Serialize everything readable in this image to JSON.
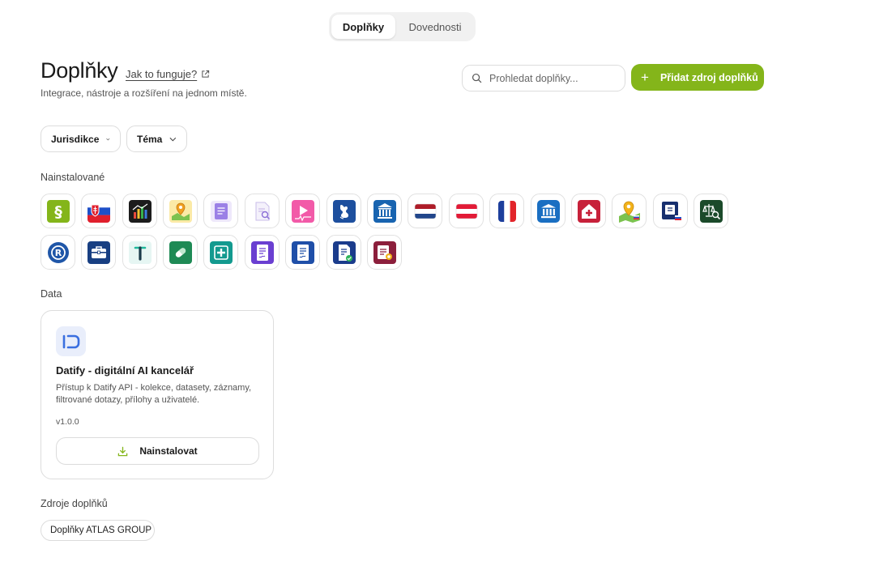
{
  "tabs": [
    {
      "label": "Doplňky"
    },
    {
      "label": "Dovednosti"
    }
  ],
  "header": {
    "title": "Doplňky",
    "how_link": "Jak to funguje?",
    "subtitle": "Integrace, nástroje a rozšíření na jednom místě."
  },
  "search": {
    "placeholder": "Prohledat doplňky..."
  },
  "add_source_button": "Přidat zdroj doplňků",
  "filters": [
    {
      "label": "Jurisdikce"
    },
    {
      "label": "Téma"
    }
  ],
  "installed": {
    "heading": "Nainstalované",
    "icons": [
      "paragraph-icon",
      "slovakia-flag-icon",
      "bar-chart-icon",
      "map-pin-icon",
      "document-icon",
      "document-search-icon",
      "video-play-icon",
      "czech-lion-emblem-icon",
      "government-building-icon",
      "netherlands-flag-icon",
      "austria-flag-icon",
      "france-flag-icon",
      "institution-icon",
      "health-house-icon",
      "map-location-icon",
      "registry-book-icon",
      "scales-search-icon",
      "registered-mark-icon",
      "briefcase-icon",
      "t-letter-icon",
      "pill-icon",
      "medical-cross-icon",
      "signed-document-icon",
      "signed-document-blue-icon",
      "approved-document-icon",
      "certified-document-icon"
    ]
  },
  "data_section": {
    "heading": "Data",
    "card": {
      "title": "Datify - digitální AI kancelář",
      "description": "Přístup k Datify API - kolekce, datasety, záznamy, filtrované dotazy, přílohy a uživatelé.",
      "version": "v1.0.0",
      "install_label": "Nainstalovat"
    }
  },
  "sources": {
    "heading": "Zdroje doplňků",
    "items": [
      {
        "label": "Doplňky ATLAS GROUP"
      }
    ]
  },
  "colors": {
    "accent": "#84b51a",
    "border": "#dcdcdc"
  }
}
